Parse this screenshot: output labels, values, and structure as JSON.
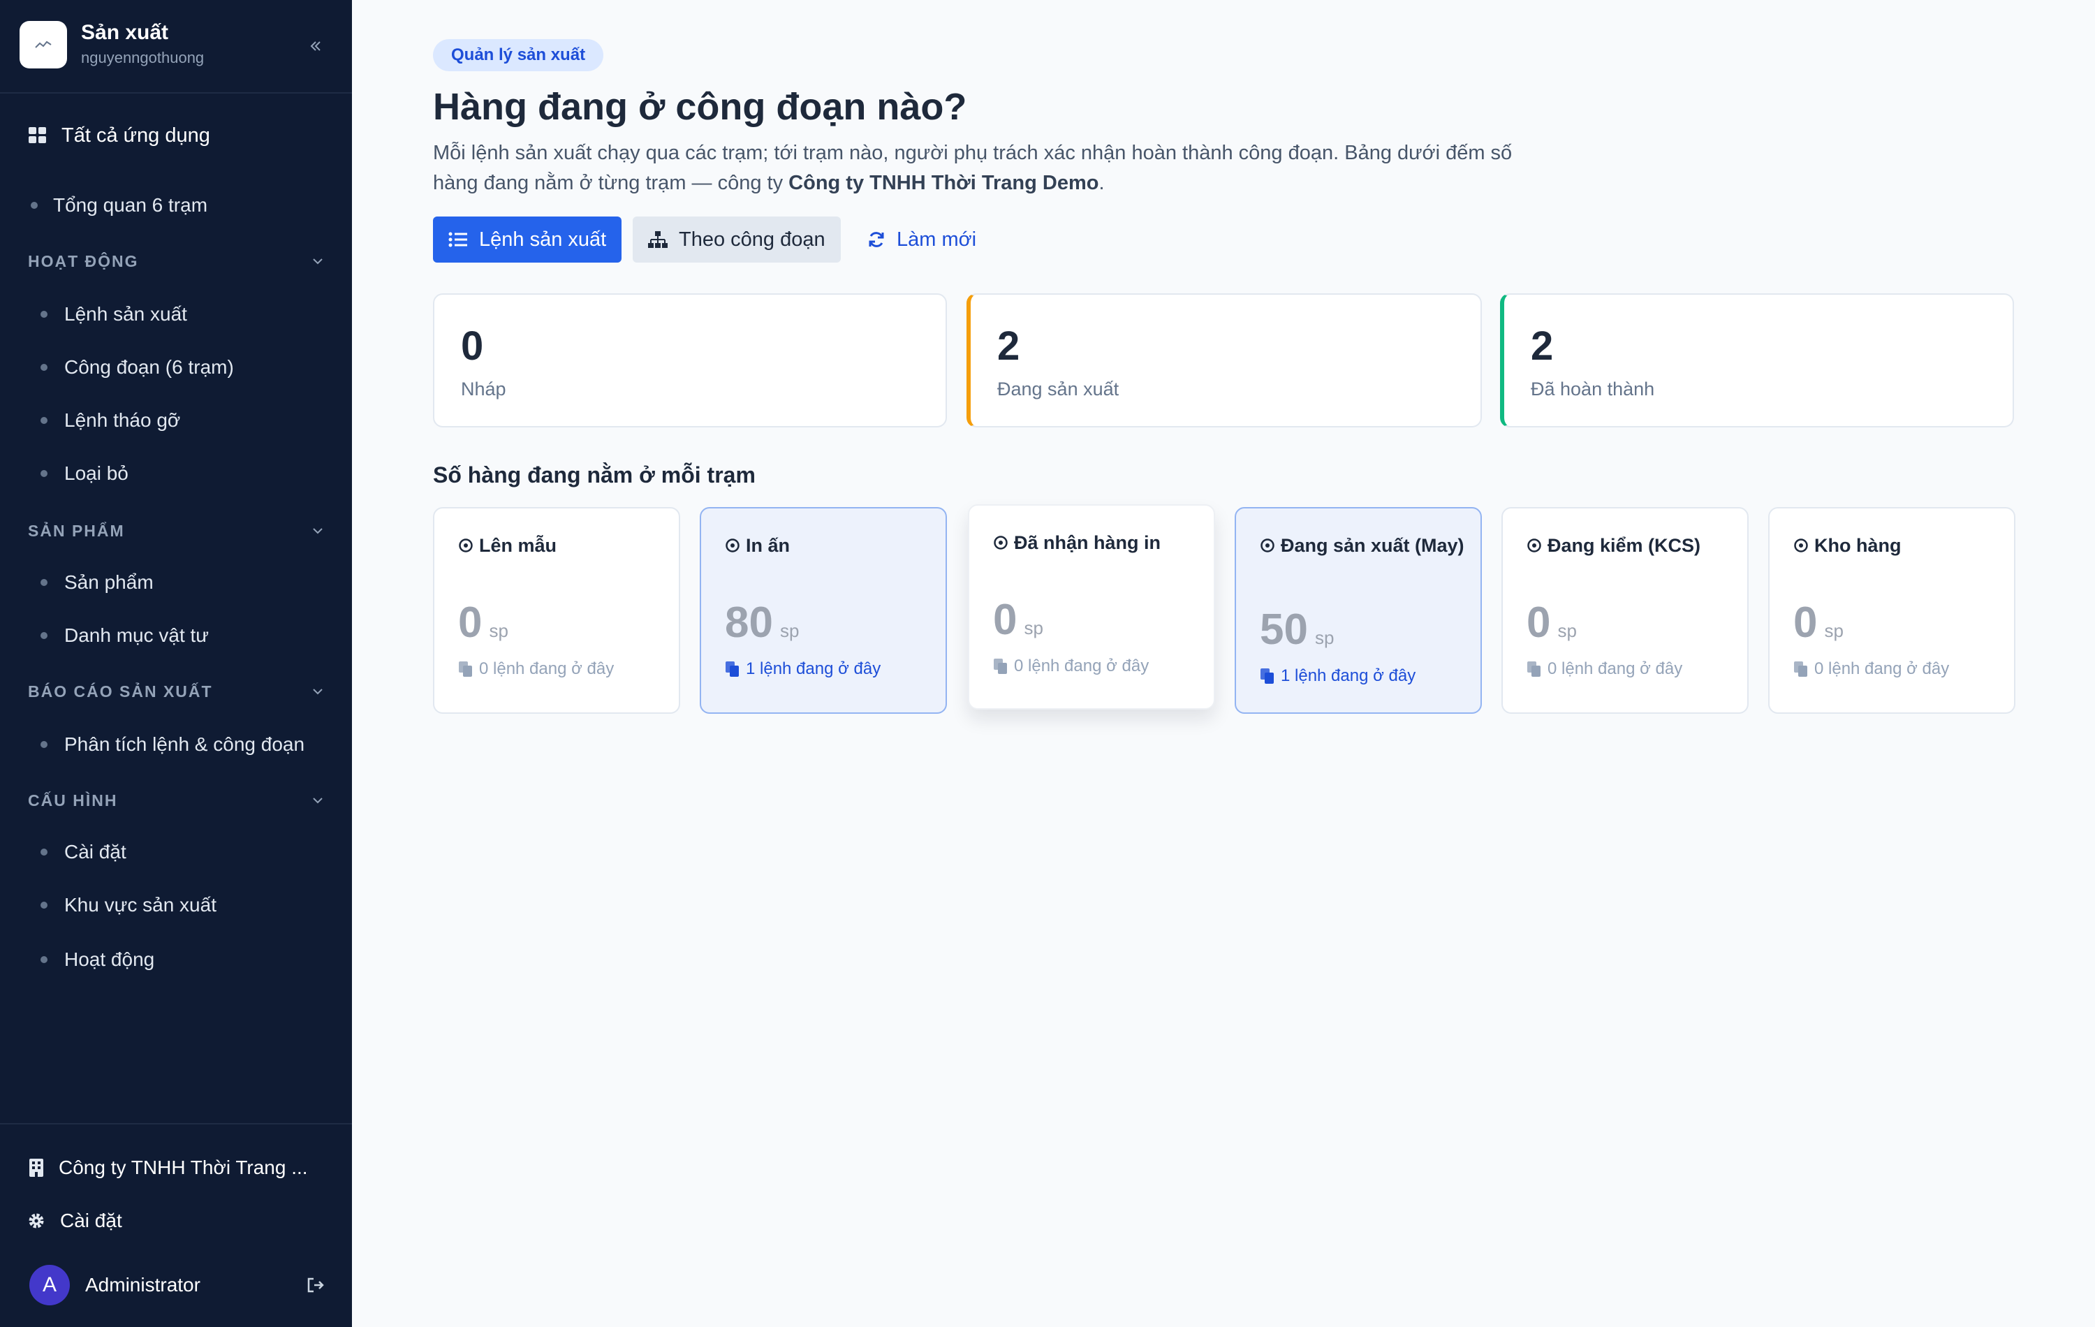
{
  "sidebar": {
    "app_title": "Sản xuất",
    "username": "nguyenngothuong",
    "all_apps_label": "Tất cả ứng dụng",
    "overview_label": "Tổng quan 6 trạm",
    "sections": [
      {
        "label": "HOẠT ĐỘNG",
        "items": [
          "Lệnh sản xuất",
          "Công đoạn (6 trạm)",
          "Lệnh tháo gỡ",
          "Loại bỏ"
        ]
      },
      {
        "label": "SẢN PHẨM",
        "items": [
          "Sản phẩm",
          "Danh mục vật tư"
        ]
      },
      {
        "label": "BÁO CÁO SẢN XUẤT",
        "items": [
          "Phân tích lệnh & công đoạn"
        ]
      },
      {
        "label": "CẤU HÌNH",
        "items": [
          "Cài đặt",
          "Khu vực sản xuất",
          "Hoạt động"
        ]
      }
    ],
    "footer": {
      "company": "Công ty TNHH Thời Trang ...",
      "settings": "Cài đặt",
      "avatar_letter": "A",
      "user": "Administrator"
    },
    "colors": {
      "background": "#0f1b33",
      "avatar": "#4338ca"
    }
  },
  "main": {
    "badge": "Quản lý sản xuất",
    "title": "Hàng đang ở công đoạn nào?",
    "description_part1": "Mỗi lệnh sản xuất chạy qua các trạm; tới trạm nào, người phụ trách xác nhận hoàn thành công đoạn. Bảng dưới đếm số hàng đang nằm ở từng trạm — công ty ",
    "description_company": "Công ty TNHH Thời Trang Demo",
    "description_end": ".",
    "buttons": {
      "orders": "Lệnh sản xuất",
      "by_stage": "Theo công đoạn",
      "refresh": "Làm mới"
    },
    "stats": [
      {
        "value": "0",
        "label": "Nháp"
      },
      {
        "value": "2",
        "label": "Đang sản xuất"
      },
      {
        "value": "2",
        "label": "Đã hoàn thành"
      }
    ],
    "stations_title": "Số hàng đang nằm ở mỗi trạm",
    "stations": [
      {
        "name": "Lên mẫu",
        "qty": "0",
        "unit": "sp",
        "orders": "0 lệnh đang ở đây"
      },
      {
        "name": "In ấn",
        "qty": "80",
        "unit": "sp",
        "orders": "1 lệnh đang ở đây"
      },
      {
        "name": "Đã nhận hàng in",
        "qty": "0",
        "unit": "sp",
        "orders": "0 lệnh đang ở đây"
      },
      {
        "name": "Đang sản xuất (May)",
        "qty": "50",
        "unit": "sp",
        "orders": "1 lệnh đang ở đây"
      },
      {
        "name": "Đang kiểm (KCS)",
        "qty": "0",
        "unit": "sp",
        "orders": "0 lệnh đang ở đây"
      },
      {
        "name": "Kho hàng",
        "qty": "0",
        "unit": "sp",
        "orders": "0 lệnh đang ở đây"
      }
    ],
    "colors": {
      "primary": "#2563eb",
      "in_progress": "#f59e0b",
      "done": "#10b981",
      "active_station_bg": "#edf2fc"
    }
  },
  "icons": [
    "chart-line-icon",
    "double-chevron-left-icon",
    "grid-icon",
    "chevron-down-icon",
    "building-icon",
    "gear-icon",
    "logout-icon",
    "list-icon",
    "sitemap-icon",
    "refresh-icon",
    "circle-dot-icon",
    "copy-icon"
  ]
}
